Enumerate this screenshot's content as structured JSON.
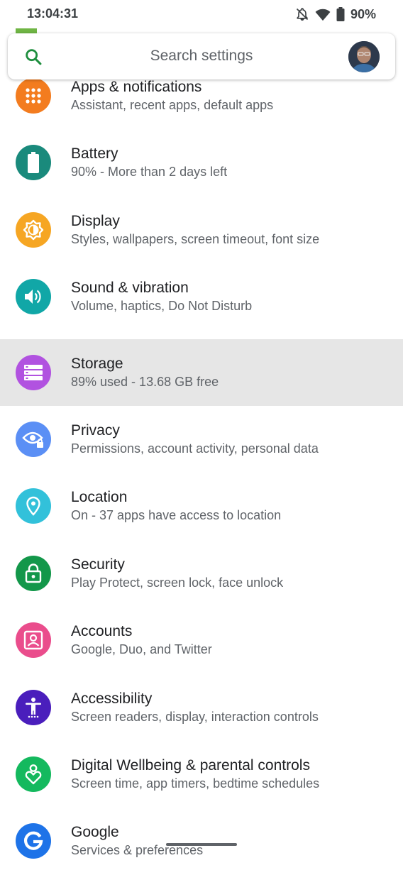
{
  "status_bar": {
    "time": "13:04:31",
    "battery_percent": "90%",
    "icons": [
      "notifications-off-icon",
      "wifi-icon",
      "battery-icon"
    ]
  },
  "search": {
    "placeholder": "Search settings"
  },
  "colors": {
    "apps": "#f37c1f",
    "battery": "#1a8a7c",
    "display": "#f6a623",
    "sound": "#11a7a7",
    "storage": "#b152e0",
    "privacy": "#5b8ff5",
    "location": "#32c1da",
    "security": "#13974a",
    "accounts": "#ea4d8c",
    "accessibility": "#4a1ebc",
    "wellbeing": "#14b95e",
    "google": "#1e73e8"
  },
  "settings": [
    {
      "title": "Apps & notifications",
      "subtitle": "Assistant, recent apps, default apps",
      "icon": "apps-grid-icon"
    },
    {
      "title": "Battery",
      "subtitle": "90% - More than 2 days left",
      "icon": "battery-icon"
    },
    {
      "title": "Display",
      "subtitle": "Styles, wallpapers, screen timeout, font size",
      "icon": "brightness-icon"
    },
    {
      "title": "Sound & vibration",
      "subtitle": "Volume, haptics, Do Not Disturb",
      "icon": "volume-icon"
    },
    {
      "title": "Storage",
      "subtitle": "89% used - 13.68 GB free",
      "icon": "storage-icon"
    },
    {
      "title": "Privacy",
      "subtitle": "Permissions, account activity, personal data",
      "icon": "privacy-eye-icon"
    },
    {
      "title": "Location",
      "subtitle": "On - 37 apps have access to location",
      "icon": "location-pin-icon"
    },
    {
      "title": "Security",
      "subtitle": "Play Protect, screen lock, face unlock",
      "icon": "lock-icon"
    },
    {
      "title": "Accounts",
      "subtitle": "Google, Duo, and Twitter",
      "icon": "account-box-icon"
    },
    {
      "title": "Accessibility",
      "subtitle": "Screen readers, display, interaction controls",
      "icon": "accessibility-icon"
    },
    {
      "title": "Digital Wellbeing & parental controls",
      "subtitle": "Screen time, app timers, bedtime schedules",
      "icon": "wellbeing-heart-icon"
    },
    {
      "title": "Google",
      "subtitle": "Services & preferences",
      "icon": "google-g-icon"
    }
  ]
}
